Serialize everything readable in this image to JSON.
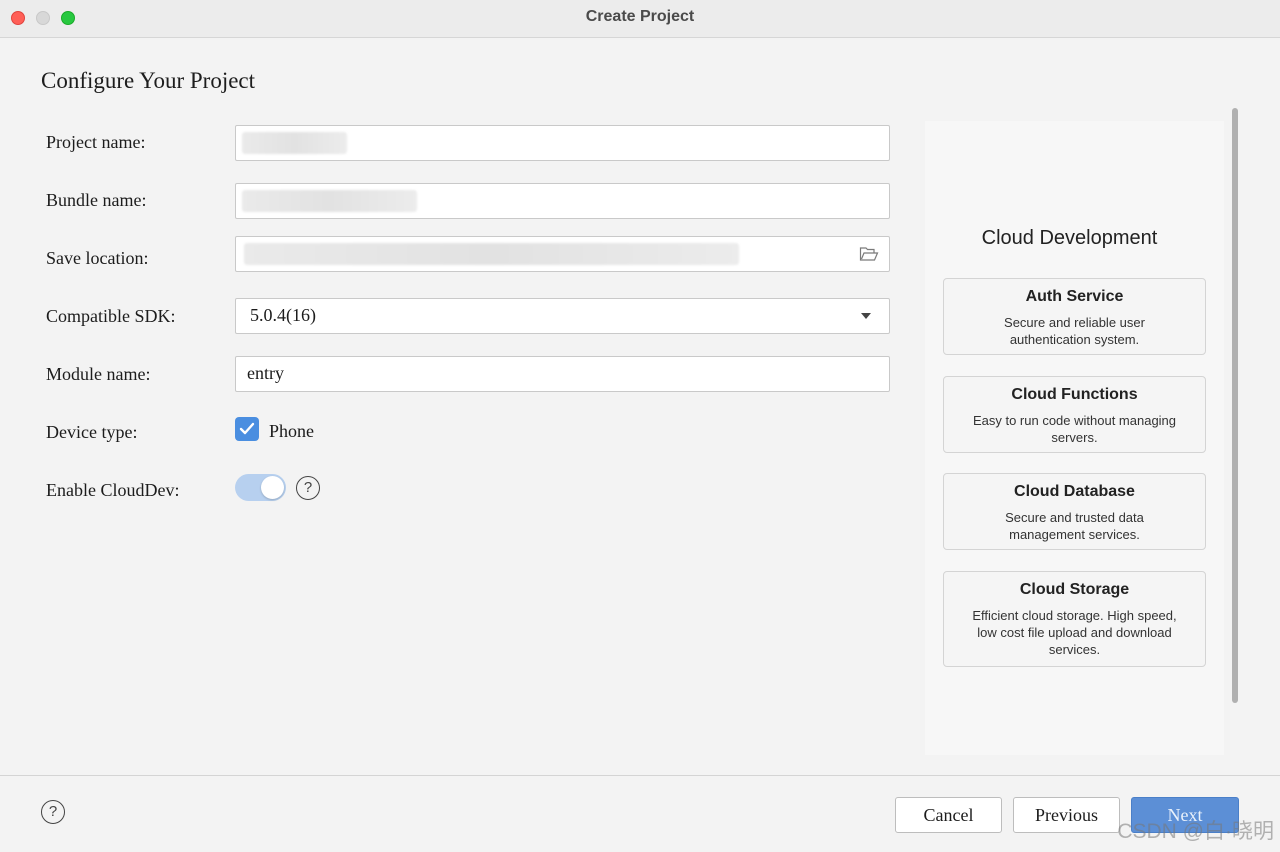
{
  "window": {
    "title": "Create Project"
  },
  "page": {
    "title": "Configure Your Project"
  },
  "form": {
    "project_name_label": "Project name:",
    "bundle_name_label": "Bundle name:",
    "save_location_label": "Save location:",
    "compatible_sdk_label": "Compatible SDK:",
    "compatible_sdk_value": "5.0.4(16)",
    "module_name_label": "Module name:",
    "module_name_value": "entry",
    "device_type_label": "Device type:",
    "device_phone_label": "Phone",
    "device_phone_checked": true,
    "enable_clouddev_label": "Enable CloudDev:",
    "enable_clouddev_on": true
  },
  "cloud": {
    "title": "Cloud Development",
    "cards": [
      {
        "title": "Auth Service",
        "desc": "Secure and reliable user authentication system."
      },
      {
        "title": "Cloud Functions",
        "desc": "Easy to run code without managing servers."
      },
      {
        "title": "Cloud Database",
        "desc": "Secure and trusted data management services."
      },
      {
        "title": "Cloud Storage",
        "desc": "Efficient cloud storage. High speed, low cost file upload and download services."
      }
    ]
  },
  "footer": {
    "help_glyph": "?",
    "cancel_label": "Cancel",
    "previous_label": "Previous",
    "next_label": "Next"
  },
  "watermark": "CSDN @白·晓明",
  "colors": {
    "accent": "#4a8ee0",
    "primary_button": "#5c8fd6",
    "toggle_on": "#b7d0ef"
  },
  "icons": [
    "folder-open-icon",
    "dropdown-caret-icon",
    "checkmark-icon",
    "help-icon"
  ]
}
